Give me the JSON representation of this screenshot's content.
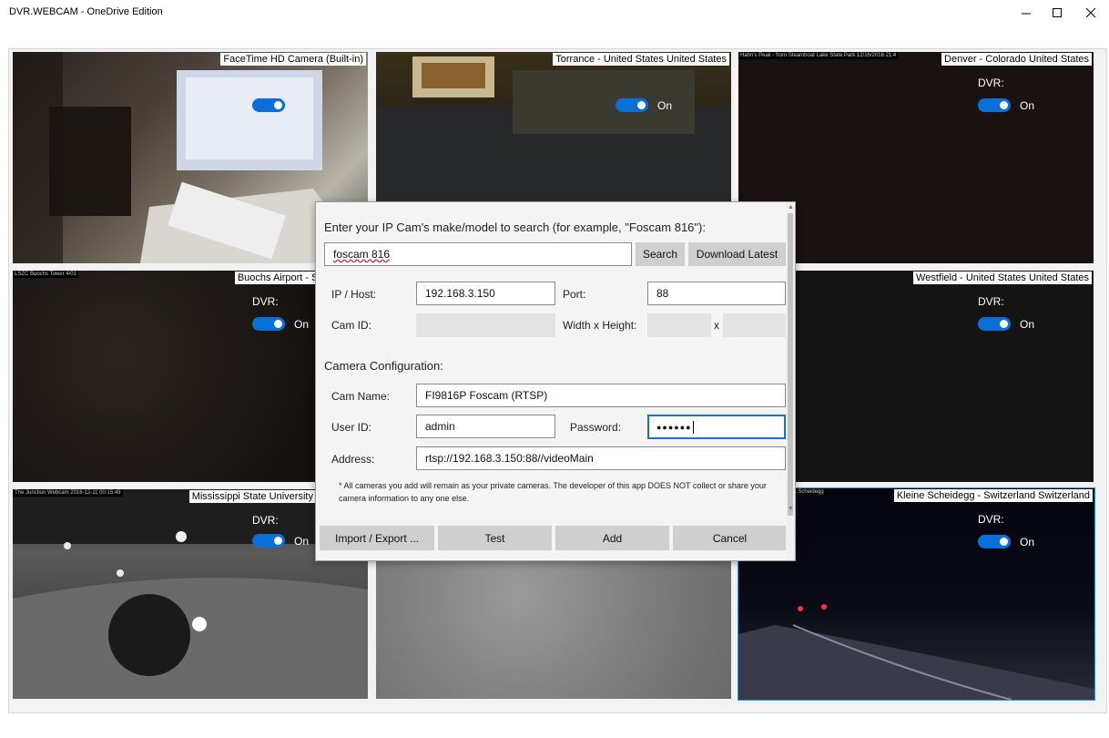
{
  "app": {
    "title": "DVR.WEBCAM - OneDrive Edition"
  },
  "window_controls": {
    "minimize": "minimize-icon",
    "maximize": "maximize-icon",
    "close": "close-icon"
  },
  "cameras": [
    {
      "name": "FaceTime HD Camera (Built-in)",
      "dvr_label": "",
      "toggle_label": "",
      "on": true
    },
    {
      "name": "Torrance - United States United States",
      "dvr_label": "",
      "toggle_label": "On",
      "on": true
    },
    {
      "name": "Denver - Colorado United States",
      "dvr_label": "DVR:",
      "toggle_label": "On",
      "on": true,
      "overlay": "Hahn's Peak - from Steamboat Lake State Park 12/16/2016 21:4"
    },
    {
      "name": "Buochs Airport - Switzerland",
      "dvr_label": "DVR:",
      "toggle_label": "On",
      "on": true,
      "overlay": "LSZC Buochs Tower 4/01"
    },
    {
      "name": "Westfield - United States United States",
      "dvr_label": "DVR:",
      "toggle_label": "On",
      "on": true
    },
    {
      "name": "Mississippi State University Junction U",
      "dvr_label": "DVR:",
      "toggle_label": "On",
      "on": true,
      "overlay": "The Junction Webcam 2016-12-11 00:15:49"
    },
    {
      "name": "",
      "dvr_label": "",
      "toggle_label": "",
      "on": false
    },
    {
      "name": "Kleine Scheidegg - Switzerland Switzerland",
      "dvr_label": "DVR:",
      "toggle_label": "On",
      "on": true,
      "overlay": "www.scheidegg.ch / Kl. Scheidegg"
    }
  ],
  "dialog": {
    "search_prompt": "Enter your IP Cam's make/model to search (for example, \"Foscam 816\"):",
    "search_value": "foscam 816",
    "search_button": "Search",
    "download_button": "Download Latest",
    "ip_label": "IP / Host:",
    "ip_value": "192.168.3.150",
    "port_label": "Port:",
    "port_value": "88",
    "camid_label": "Cam ID:",
    "camid_value": "",
    "wh_label": "Width x Height:",
    "wh_sep": "x",
    "width_value": "",
    "height_value": "",
    "config_heading": "Camera Configuration:",
    "camname_label": "Cam Name:",
    "camname_value": "FI9816P Foscam (RTSP)",
    "userid_label": "User ID:",
    "userid_value": "admin",
    "password_label": "Password:",
    "password_value": "●●●●●●",
    "address_label": "Address:",
    "address_value": "rtsp://192.168.3.150:88//videoMain",
    "note": "* All cameras you add will remain as your private cameras.  The developer of this app DOES NOT collect or share your camera information to any one else.",
    "buttons": {
      "import": "Import / Export ...",
      "test": "Test",
      "add": "Add",
      "cancel": "Cancel"
    }
  },
  "colors": {
    "accent": "#0a6fd8",
    "focus_border": "#1673c9",
    "selected_tile_border": "#3a8fd6"
  }
}
